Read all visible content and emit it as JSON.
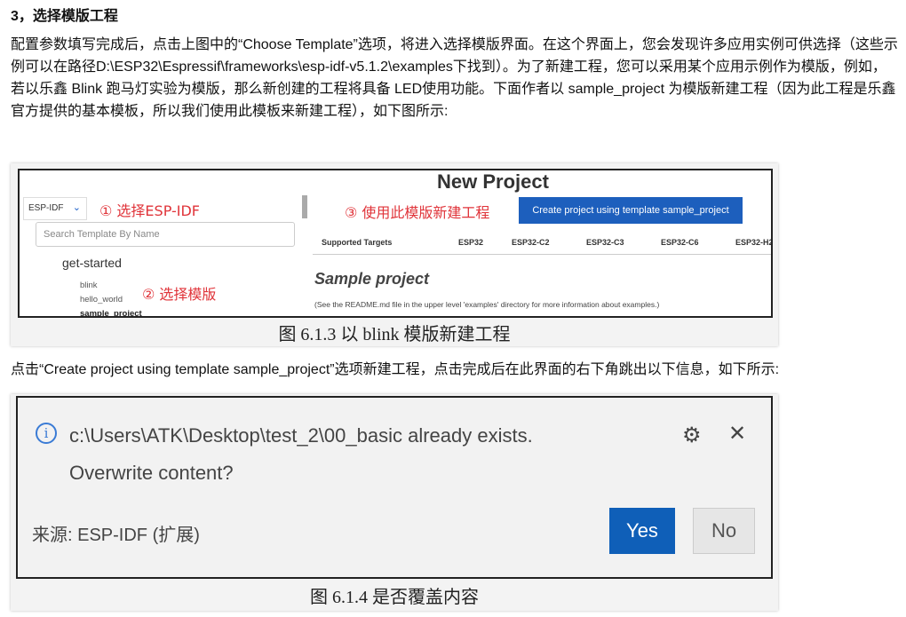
{
  "heading": "3，选择模版工程",
  "paragraph1": "配置参数填写完成后，点击上图中的“Choose Template”选项，将进入选择模版界面。在这个界面上，您会发现许多应用实例可供选择（这些示例可以在路径D:\\ESP32\\Espressif\\frameworks\\esp-idf-v5.1.2\\examples下找到）。为了新建工程，您可以采用某个应用示例作为模版，例如，若以乐鑫 Blink 跑马灯实验为模版，那么新创建的工程将具备 LED使用功能。下面作者以 sample_project 为模版新建工程（因为此工程是乐鑫官方提供的基本模板，所以我们使用此模板来新建工程），如下图所示:",
  "paragraph2": "点击“Create project using template sample_project”选项新建工程，点击完成后在此界面的右下角跳出以下信息，如下所示:",
  "figure1": {
    "idf_select": "ESP-IDF",
    "annotation1": "① 选择ESP-IDF",
    "annotation2": "② 选择模版",
    "annotation3": "③ 使用此模版新建工程",
    "search_placeholder": "Search Template By Name",
    "group": "get-started",
    "items": [
      "blink",
      "hello_world",
      "sample_project"
    ],
    "title": "New Project",
    "create_button": "Create project using template sample_project",
    "targets_label": "Supported Targets",
    "targets": [
      "ESP32",
      "ESP32-C2",
      "ESP32-C3",
      "ESP32-C6",
      "ESP32-H2"
    ],
    "sample_title": "Sample project",
    "sample_desc": "(See the README.md file in the upper level 'examples' directory for more information about examples.)",
    "caption": "图 6.1.3 以 blink 模版新建工程"
  },
  "figure2": {
    "message_line1": "c:\\Users\\ATK\\Desktop\\test_2\\00_basic already exists.",
    "message_line2": "Overwrite content?",
    "source": "来源: ESP-IDF (扩展)",
    "yes": "Yes",
    "no": "No",
    "caption": "图 6.1.4 是否覆盖内容"
  }
}
